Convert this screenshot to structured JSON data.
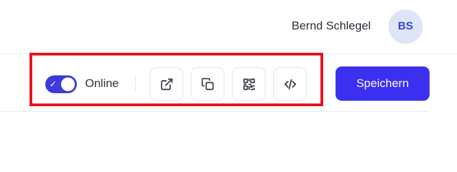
{
  "header": {
    "user_name": "Bernd Schlegel",
    "avatar_initials": "BS"
  },
  "toolbar": {
    "online_toggle": {
      "checked": true,
      "label": "Online"
    },
    "icon_buttons": [
      {
        "icon": "external-link-icon"
      },
      {
        "icon": "copy-icon"
      },
      {
        "icon": "qr-code-icon"
      },
      {
        "icon": "code-icon"
      }
    ],
    "save_label": "Speichern"
  },
  "colors": {
    "accent": "#3b2ff0",
    "toggle_on": "#3d3bdb",
    "avatar_bg": "#dde5f7",
    "avatar_text": "#3b45d6",
    "highlight": "#e8121d"
  }
}
